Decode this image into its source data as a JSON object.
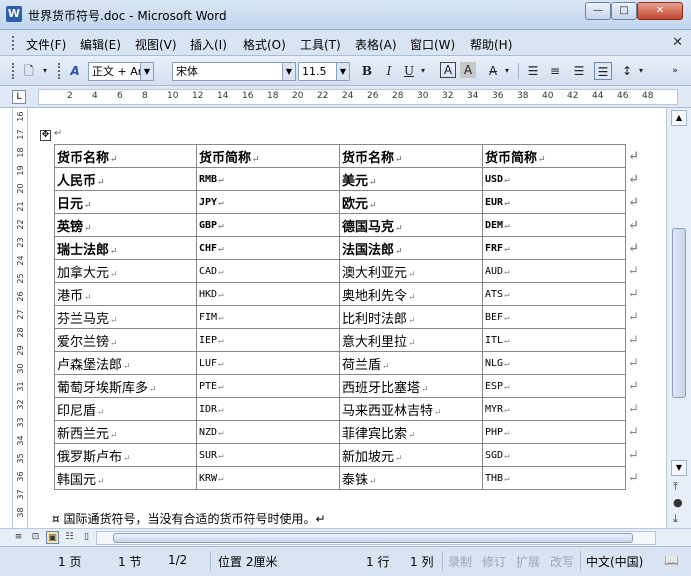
{
  "window": {
    "title": "世界货币符号.doc - Microsoft Word",
    "minimize": "—",
    "maximize": "□",
    "close": "✕"
  },
  "menu": [
    "文件(F)",
    "编辑(E)",
    "视图(V)",
    "插入(I)",
    "格式(O)",
    "工具(T)",
    "表格(A)",
    "窗口(W)",
    "帮助(H)"
  ],
  "toolbar": {
    "style_combo": "正文 + Aria",
    "font_combo": "宋体",
    "size_combo": "11.5",
    "bold": "B",
    "italic": "I",
    "underline": "U"
  },
  "ruler": {
    "h_ticks": [
      "2",
      "4",
      "6",
      "8",
      "10",
      "12",
      "14",
      "16",
      "18",
      "20",
      "22",
      "24",
      "26",
      "28",
      "30",
      "32",
      "34",
      "36",
      "38",
      "40",
      "42",
      "44",
      "46",
      "48"
    ],
    "v_ticks": [
      "16",
      "17",
      "18",
      "19",
      "20",
      "21",
      "22",
      "23",
      "24",
      "25",
      "26",
      "27",
      "28",
      "29",
      "30",
      "31",
      "32",
      "33",
      "34",
      "35",
      "36",
      "37",
      "38"
    ]
  },
  "table": {
    "header": [
      "货币名称",
      "货币简称",
      "货币名称",
      "货币简称"
    ],
    "rows": [
      {
        "bold": true,
        "cells": [
          "人民币",
          "RMB",
          "美元",
          "USD"
        ]
      },
      {
        "bold": true,
        "cells": [
          "日元",
          "JPY",
          "欧元",
          "EUR"
        ]
      },
      {
        "bold": true,
        "cells": [
          "英镑",
          "GBP",
          "德国马克",
          "DEM"
        ]
      },
      {
        "bold": true,
        "cells": [
          "瑞士法郎",
          "CHF",
          "法国法郎",
          "FRF"
        ]
      },
      {
        "bold": false,
        "cells": [
          "加拿大元",
          "CAD",
          "澳大利亚元",
          "AUD"
        ]
      },
      {
        "bold": false,
        "cells": [
          "港币",
          "HKD",
          "奥地利先令",
          "ATS"
        ]
      },
      {
        "bold": false,
        "cells": [
          "芬兰马克",
          "FIM",
          "比利时法郎",
          "BEF"
        ]
      },
      {
        "bold": false,
        "cells": [
          "爱尔兰镑",
          "IEP",
          "意大利里拉",
          "ITL"
        ]
      },
      {
        "bold": false,
        "cells": [
          "卢森堡法郎",
          "LUF",
          "荷兰盾",
          "NLG"
        ]
      },
      {
        "bold": false,
        "cells": [
          "葡萄牙埃斯库多",
          "PTE",
          "西班牙比塞塔",
          "ESP"
        ]
      },
      {
        "bold": false,
        "cells": [
          "印尼盾",
          "IDR",
          "马来西亚林吉特",
          "MYR"
        ]
      },
      {
        "bold": false,
        "cells": [
          "新西兰元",
          "NZD",
          "菲律宾比索",
          "PHP"
        ]
      },
      {
        "bold": false,
        "cells": [
          "俄罗斯卢布",
          "SUR",
          "新加坡元",
          "SGD"
        ]
      },
      {
        "bold": false,
        "cells": [
          "韩国元",
          "KRW",
          "泰铢",
          "THB"
        ]
      }
    ]
  },
  "footnote": "¤ 国际通货符号，当没有合适的货币符号时使用。↵",
  "status": {
    "page": "1 页",
    "section": "1 节",
    "pages": "1/2",
    "position": "位置 2厘米",
    "line": "1 行",
    "column": "1 列",
    "rec": "录制",
    "trk": "修订",
    "ext": "扩展",
    "ovr": "改写",
    "language": "中文(中国)"
  }
}
